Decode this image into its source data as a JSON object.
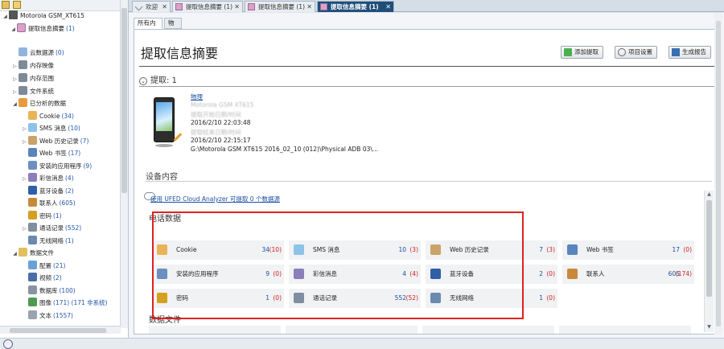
{
  "tree": {
    "device": {
      "label": "Motorola GSM_XT615"
    },
    "extract_summary": {
      "label": "提取信息摘要",
      "count": "(1)"
    },
    "nodes": [
      {
        "label": "云数据源",
        "count": "(0)",
        "arrow": "",
        "color": "#8fb4e0"
      },
      {
        "label": "内存映像",
        "count": "",
        "arrow": "▷",
        "color": "#7d8a99"
      },
      {
        "label": "内存范围",
        "count": "",
        "arrow": "▷",
        "color": "#7d8a99"
      },
      {
        "label": "文件系统",
        "count": "",
        "arrow": "▷",
        "color": "#7d8a99"
      },
      {
        "label": "已分析的数据",
        "count": "",
        "arrow": "◢",
        "color": "#e79b3c"
      },
      {
        "label": "Cookie",
        "count": "(34)",
        "arrow": "",
        "color": "#e9b455"
      },
      {
        "label": "SMS 消息",
        "count": "(10)",
        "arrow": "▷",
        "color": "#8cc3e8"
      },
      {
        "label": "Web 历史记录",
        "count": "(7)",
        "arrow": "▷",
        "color": "#c9a36a"
      },
      {
        "label": "Web 书签",
        "count": "(17)",
        "arrow": "",
        "color": "#5a84c0"
      },
      {
        "label": "安装的应用程序",
        "count": "(9)",
        "arrow": "",
        "color": "#6b8fbf"
      },
      {
        "label": "彩信消息",
        "count": "(4)",
        "arrow": "▷",
        "color": "#8a7fb8"
      },
      {
        "label": "蓝牙设备",
        "count": "(2)",
        "arrow": "",
        "color": "#2f5fa8"
      },
      {
        "label": "联系人",
        "count": "(605)",
        "arrow": "",
        "color": "#c88a3a"
      },
      {
        "label": "密码",
        "count": "(1)",
        "arrow": "",
        "color": "#d4a020"
      },
      {
        "label": "通话记录",
        "count": "(552)",
        "arrow": "▷",
        "color": "#7f8ea0"
      },
      {
        "label": "无线网络",
        "count": "(1)",
        "arrow": "",
        "color": "#6a8ab0"
      },
      {
        "label": "数据文件",
        "count": "",
        "arrow": "◢",
        "color": "#e0c060"
      },
      {
        "label": "配置",
        "count": "(21)",
        "arrow": "",
        "color": "#6aa0d8"
      },
      {
        "label": "视频",
        "count": "(2)",
        "arrow": "",
        "color": "#4a6fa5"
      },
      {
        "label": "数据库",
        "count": "(100)",
        "arrow": "",
        "color": "#8894a2"
      },
      {
        "label": "图像",
        "count": "(171) (171 非系统)",
        "arrow": "",
        "color": "#4f9a4f"
      },
      {
        "label": "文本",
        "count": "(1557)",
        "arrow": "",
        "color": "#9aa4b0"
      }
    ]
  },
  "doc_tabs": [
    {
      "label": "欢迎"
    },
    {
      "label": "提取信息摘要 (1)"
    },
    {
      "label": "提取信息摘要 (1)"
    },
    {
      "label": "提取信息摘要 (1)"
    }
  ],
  "sub_tabs": [
    "所有内容",
    "物理"
  ],
  "page": {
    "title": "提取信息摘要",
    "buttons": {
      "add": "添加提取",
      "project_settings": "项目设置",
      "generate_report": "生成报告"
    },
    "extract_header": "提取: 1",
    "extract": {
      "type_link": "物理",
      "model_blur": "Motorola GSM XT615",
      "start_label": "提取开始日期/时间",
      "start_value": "2016/2/10 22:03:48",
      "end_label": "提取结束日期/时间",
      "end_value": "2016/2/10 22:15:17",
      "path": "G:\\Motorola GSM XT615 2016_02_10 (012)\\Physical ADB 03\\..."
    },
    "device_content": "设备内容",
    "ufed_link": "使用 UFED Cloud Analyzer 可提取 0 个数据源",
    "phone_data_title": "电话数据",
    "data_files_title": "数据文件",
    "phone_data": [
      {
        "label": "Cookie",
        "value": "34",
        "paren": "(10)",
        "color": "#e9b455"
      },
      {
        "label": "SMS 消息",
        "value": "10",
        "paren": "(3)",
        "color": "#8cc3e8"
      },
      {
        "label": "Web 历史记录",
        "value": "7",
        "paren": "(3)",
        "color": "#c9a36a"
      },
      {
        "label": "Web 书签",
        "value": "17",
        "paren": "(0)",
        "color": "#5a84c0"
      },
      {
        "label": "安装的应用程序",
        "value": "9",
        "paren": "(0)",
        "color": "#6b8fbf"
      },
      {
        "label": "彩信消息",
        "value": "4",
        "paren": "(4)",
        "color": "#8a7fb8"
      },
      {
        "label": "蓝牙设备",
        "value": "2",
        "paren": "(0)",
        "color": "#2f5fa8"
      },
      {
        "label": "联系人",
        "value": "605",
        "paren": "(174)",
        "color": "#c88a3a"
      },
      {
        "label": "密码",
        "value": "1",
        "paren": "(0)",
        "color": "#d4a020"
      },
      {
        "label": "通话记录",
        "value": "552",
        "paren": "(52)",
        "color": "#7f8ea0"
      },
      {
        "label": "无线网络",
        "value": "1",
        "paren": "(0)",
        "color": "#6a8ab0"
      }
    ]
  }
}
